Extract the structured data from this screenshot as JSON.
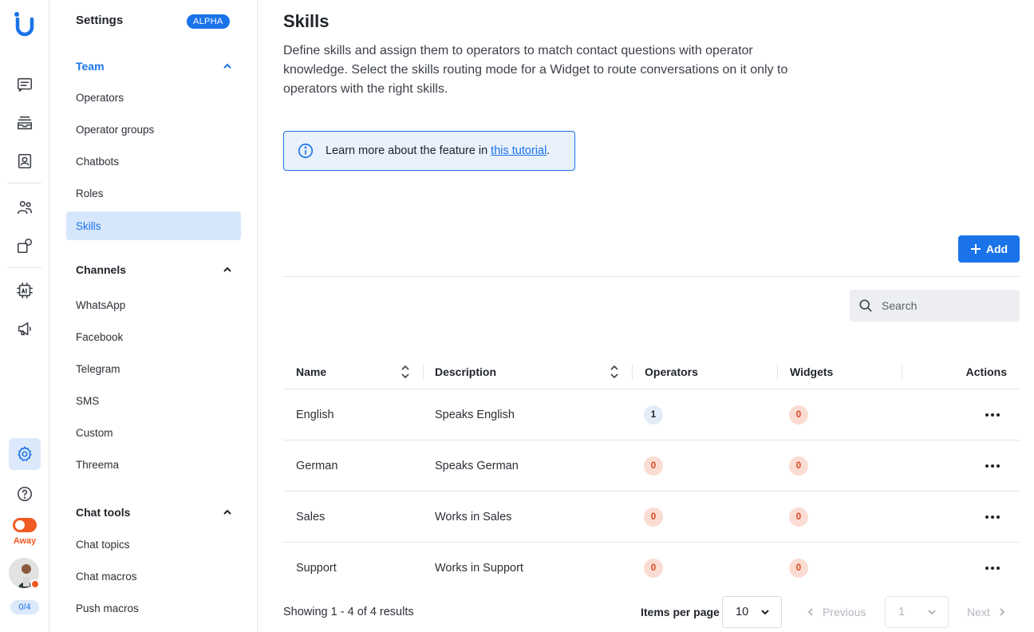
{
  "rail": {
    "status_label": "Away",
    "counter": "0/4",
    "colors": {
      "accent": "#1a73e8",
      "status": "#f05a22"
    }
  },
  "sidebar": {
    "title": "Settings",
    "badge": "ALPHA",
    "sections": [
      {
        "label": "Team",
        "items": [
          "Operators",
          "Operator groups",
          "Chatbots",
          "Roles",
          "Skills"
        ]
      },
      {
        "label": "Channels",
        "items": [
          "WhatsApp",
          "Facebook",
          "Telegram",
          "SMS",
          "Custom",
          "Threema"
        ]
      },
      {
        "label": "Chat tools",
        "items": [
          "Chat topics",
          "Chat macros",
          "Push macros"
        ]
      }
    ],
    "active_item": "Skills"
  },
  "main": {
    "title": "Skills",
    "description": "Define skills and assign them to operators to match contact questions with operator knowledge. Select the skills routing mode for a Widget to route conversations on it only to operators with the right skills.",
    "info": {
      "text": "Learn more about the feature in ",
      "link": "this tutorial",
      "suffix": "."
    },
    "add_label": "Add",
    "search_placeholder": "Search",
    "table": {
      "columns": [
        "Name",
        "Description",
        "Operators",
        "Widgets",
        "Actions"
      ],
      "rows": [
        {
          "name": "English",
          "description": "Speaks English",
          "operators": "1",
          "widgets": "0"
        },
        {
          "name": "German",
          "description": "Speaks German",
          "operators": "0",
          "widgets": "0"
        },
        {
          "name": "Sales",
          "description": "Works in Sales",
          "operators": "0",
          "widgets": "0"
        },
        {
          "name": "Support",
          "description": "Works in Support",
          "operators": "0",
          "widgets": "0"
        }
      ]
    },
    "pagination": {
      "showing": "Showing 1 - 4 of 4 results",
      "items_per_page_label": "Items per page",
      "items_per_page": "10",
      "previous": "Previous",
      "page": "1",
      "next": "Next"
    }
  }
}
